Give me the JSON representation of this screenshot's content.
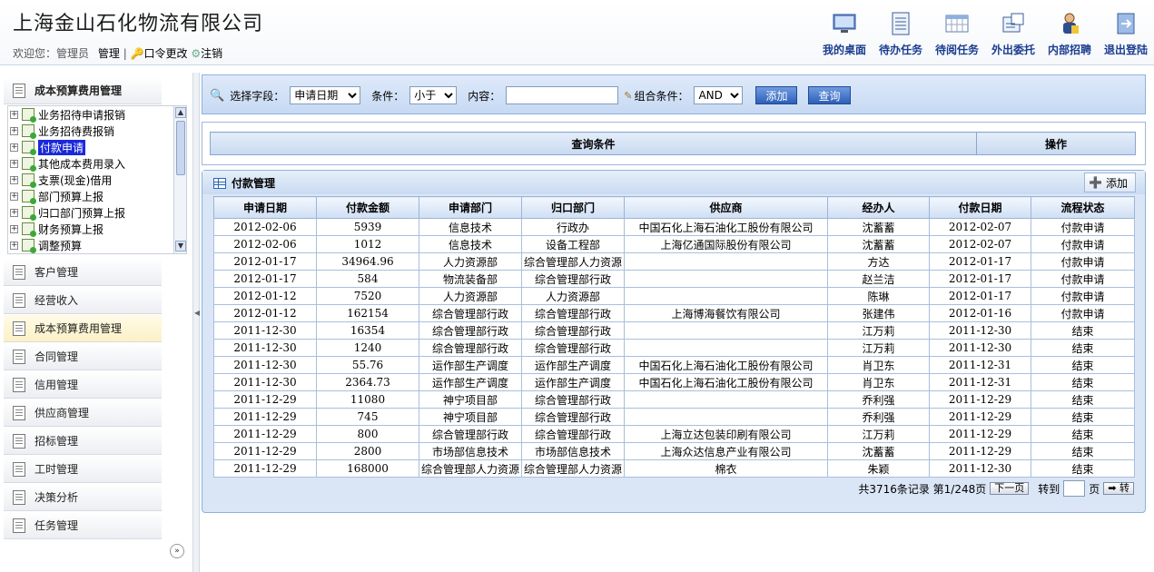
{
  "company": "上海金山石化物流有限公司",
  "user": {
    "welcome": "欢迎您：管理员",
    "manage": "管理",
    "sep": "|",
    "password": "口令更改",
    "logout": "注销"
  },
  "topnav": [
    {
      "label": "我的桌面",
      "icon": "desktop-monitor-icon"
    },
    {
      "label": "待办任务",
      "icon": "document-list-icon"
    },
    {
      "label": "待阅任务",
      "icon": "calendar-grid-icon"
    },
    {
      "label": "外出委托",
      "icon": "delegate-card-icon"
    },
    {
      "label": "内部招聘",
      "icon": "person-recruit-icon"
    },
    {
      "label": "退出登陆",
      "icon": "exit-arrow-icon"
    }
  ],
  "sidebar": {
    "active_section": "成本预算费用管理",
    "tree": [
      "业务招待申请报销",
      "业务招待费报销",
      "付款申请",
      "其他成本费用录入",
      "支票(现金)借用",
      "部门预算上报",
      "归口部门预算上报",
      "财务预算上报",
      "调整预算"
    ],
    "selected": "付款申请",
    "sections": [
      "客户管理",
      "经营收入",
      "成本预算费用管理",
      "合同管理",
      "信用管理",
      "供应商管理",
      "招标管理",
      "工时管理",
      "决策分析",
      "任务管理"
    ]
  },
  "search": {
    "field_label": "选择字段：",
    "field_value": "申请日期",
    "cond_label": "条件：",
    "cond_value": "小于",
    "content_label": "内容：",
    "content_value": "",
    "combo_label": "组合条件：",
    "combo_value": "AND",
    "add": "添加",
    "query": "查询"
  },
  "query_table": {
    "col1": "查询条件",
    "col2": "操作"
  },
  "grid": {
    "title": "付款管理",
    "add": "添加",
    "headers": [
      "申请日期",
      "付款金额",
      "申请部门",
      "归口部门",
      "供应商",
      "经办人",
      "付款日期",
      "流程状态"
    ],
    "rows": [
      [
        "2012-02-06",
        "5939",
        "信息技术",
        "行政办",
        "中国石化上海石油化工股份有限公司",
        "沈蓄蓄",
        "2012-02-07",
        "付款申请"
      ],
      [
        "2012-02-06",
        "1012",
        "信息技术",
        "设备工程部",
        "上海亿通国际股份有限公司",
        "沈蓄蓄",
        "2012-02-07",
        "付款申请"
      ],
      [
        "2012-01-17",
        "34964.96",
        "人力资源部",
        "综合管理部人力资源",
        "",
        "方达",
        "2012-01-17",
        "付款申请"
      ],
      [
        "2012-01-17",
        "584",
        "物流装备部",
        "综合管理部行政",
        "",
        "赵兰洁",
        "2012-01-17",
        "付款申请"
      ],
      [
        "2012-01-12",
        "7520",
        "人力资源部",
        "人力资源部",
        "",
        "陈琳",
        "2012-01-17",
        "付款申请"
      ],
      [
        "2012-01-12",
        "162154",
        "综合管理部行政",
        "综合管理部行政",
        "上海博海餐饮有限公司",
        "张建伟",
        "2012-01-16",
        "付款申请"
      ],
      [
        "2011-12-30",
        "16354",
        "综合管理部行政",
        "综合管理部行政",
        "",
        "江万莉",
        "2011-12-30",
        "结束"
      ],
      [
        "2011-12-30",
        "1240",
        "综合管理部行政",
        "综合管理部行政",
        "",
        "江万莉",
        "2011-12-30",
        "结束"
      ],
      [
        "2011-12-30",
        "55.76",
        "运作部生产调度",
        "运作部生产调度",
        "中国石化上海石油化工股份有限公司",
        "肖卫东",
        "2011-12-31",
        "结束"
      ],
      [
        "2011-12-30",
        "2364.73",
        "运作部生产调度",
        "运作部生产调度",
        "中国石化上海石油化工股份有限公司",
        "肖卫东",
        "2011-12-31",
        "结束"
      ],
      [
        "2011-12-29",
        "11080",
        "神宁项目部",
        "综合管理部行政",
        "",
        "乔利强",
        "2011-12-29",
        "结束"
      ],
      [
        "2011-12-29",
        "745",
        "神宁项目部",
        "综合管理部行政",
        "",
        "乔利强",
        "2011-12-29",
        "结束"
      ],
      [
        "2011-12-29",
        "800",
        "综合管理部行政",
        "综合管理部行政",
        "上海立达包装印刷有限公司",
        "江万莉",
        "2011-12-29",
        "结束"
      ],
      [
        "2011-12-29",
        "2800",
        "市场部信息技术",
        "市场部信息技术",
        "上海众达信息产业有限公司",
        "沈蓄蓄",
        "2011-12-29",
        "结束"
      ],
      [
        "2011-12-29",
        "168000",
        "综合管理部人力资源",
        "综合管理部人力资源",
        "棉衣",
        "朱颖",
        "2011-12-30",
        "结束"
      ]
    ]
  },
  "pager": {
    "summary": "共3716条记录 第1/248页",
    "next": "下一页",
    "goto_label": "转到",
    "page_unit": "页",
    "go": "转",
    "goto_value": ""
  },
  "colors": {
    "nav_text": "#1a3d8f",
    "selected_bg": "#1a29d9",
    "panel_border": "#8fb1dd"
  }
}
